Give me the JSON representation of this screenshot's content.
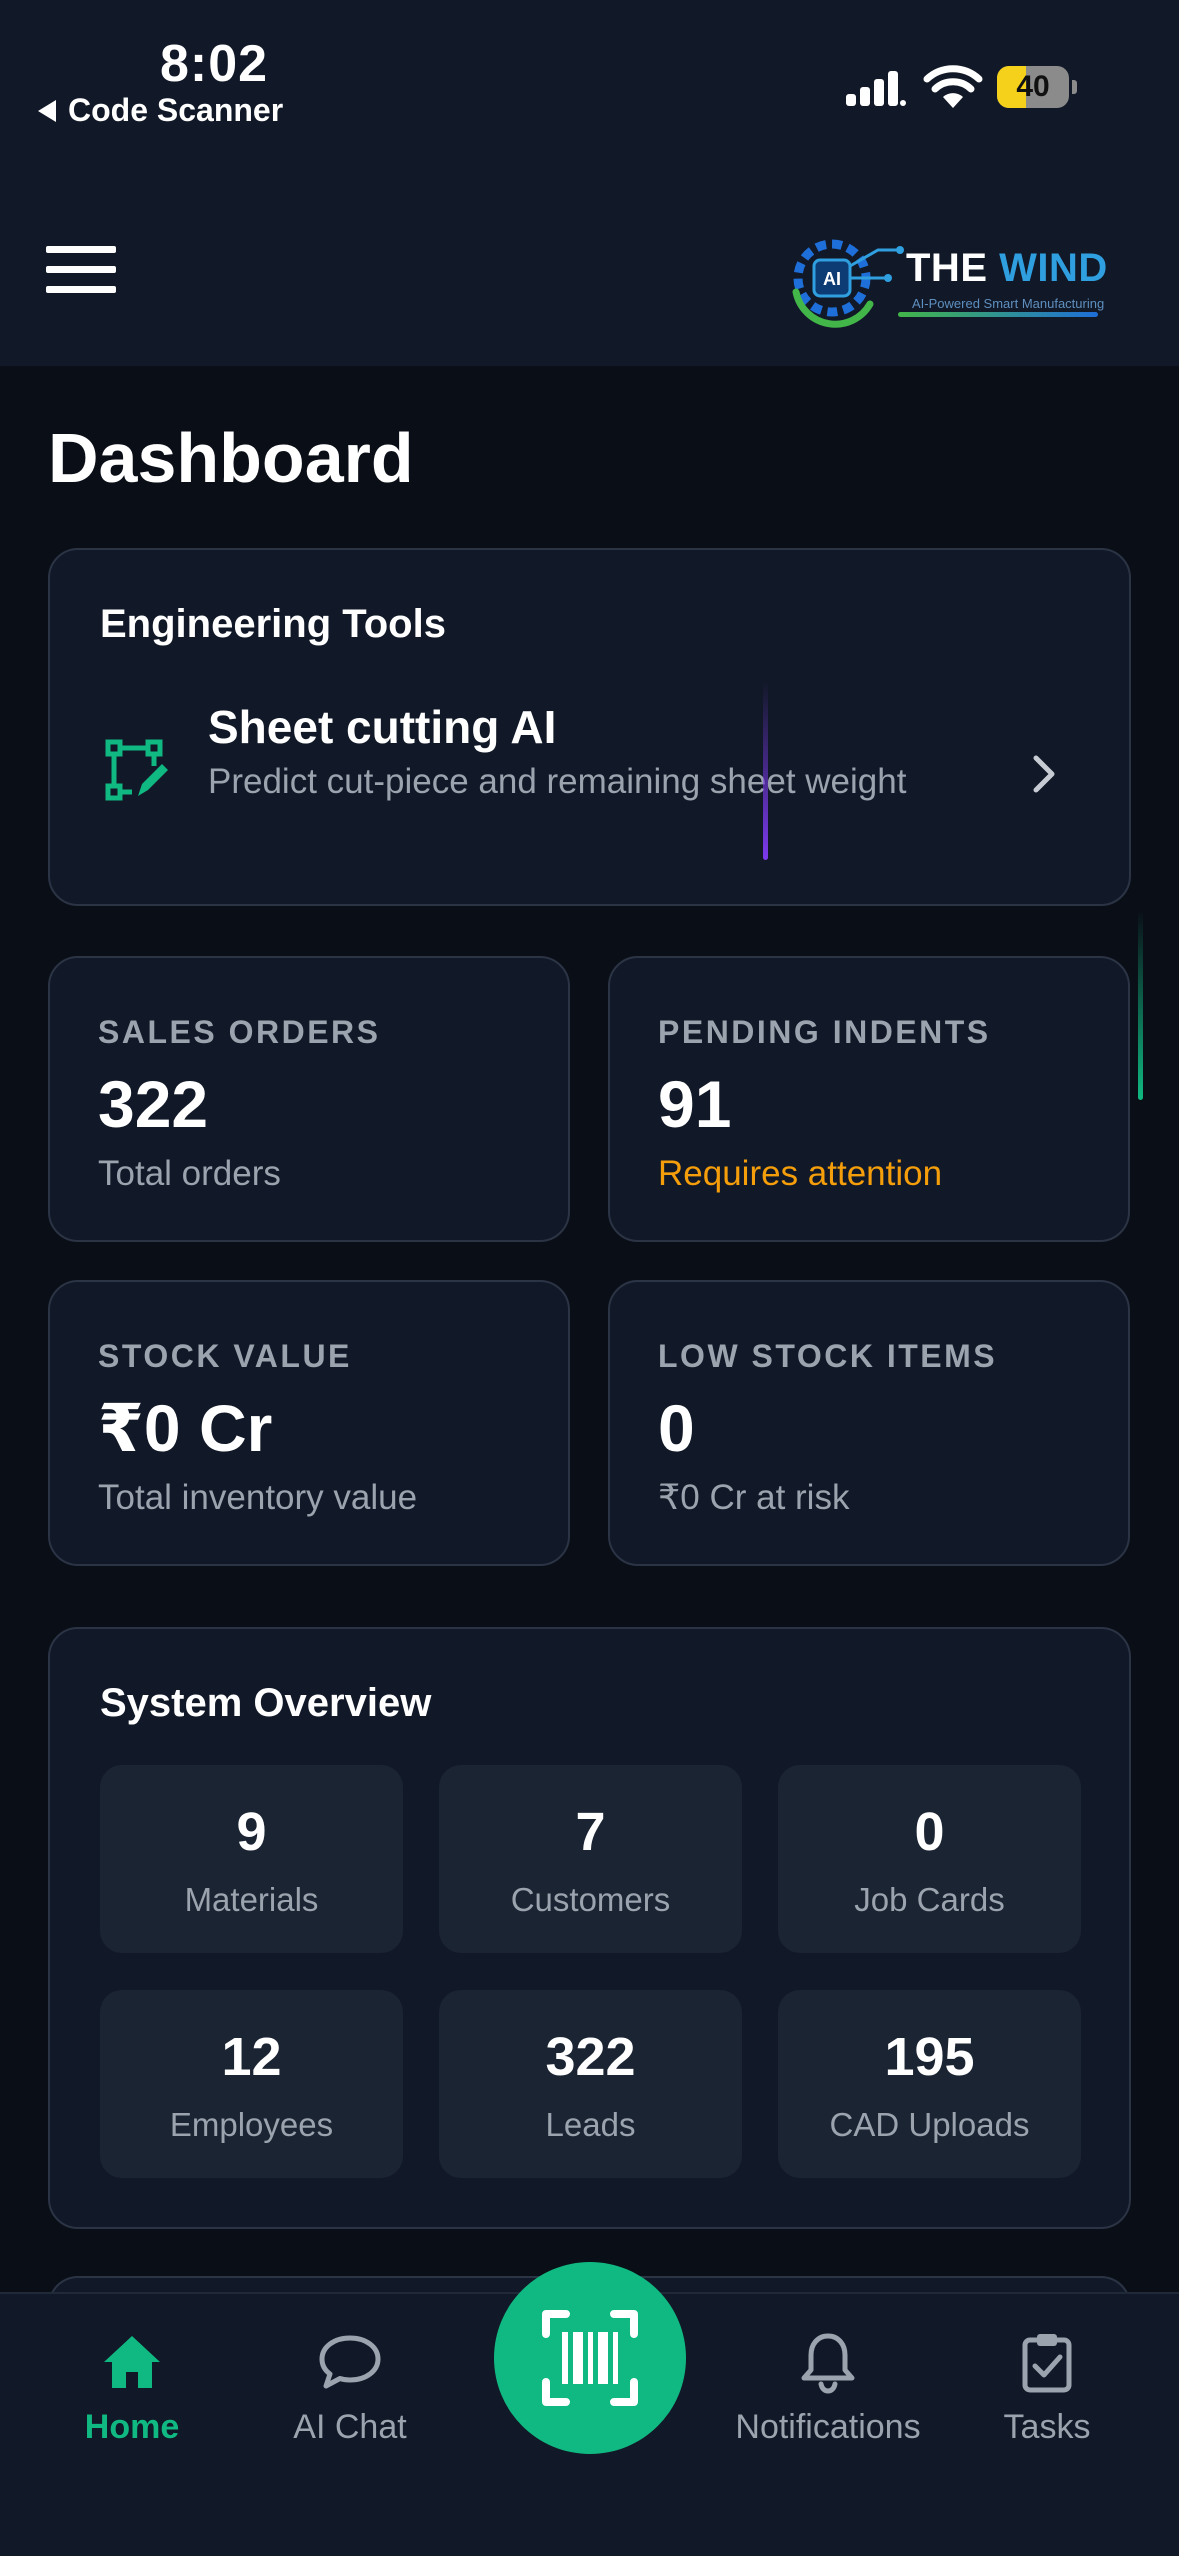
{
  "status_bar": {
    "time": "8:02",
    "back_app": "Code Scanner",
    "battery": "40",
    "battery_level": 0.4
  },
  "header": {
    "logo": {
      "word1": "THE",
      "word2": "WIND",
      "tagline": "AI-Powered Smart Manufacturing",
      "badge": "AI"
    }
  },
  "page": {
    "title": "Dashboard"
  },
  "engineering_tools": {
    "title": "Engineering Tools",
    "tool": {
      "name": "Sheet cutting AI",
      "description": "Predict cut-piece and remaining sheet weight",
      "icon": "vector-edit-icon"
    }
  },
  "stats": [
    {
      "label": "SALES ORDERS",
      "value": "322",
      "sub": "Total orders"
    },
    {
      "label": "PENDING INDENTS",
      "value": "91",
      "sub": "Requires attention"
    },
    {
      "label": "STOCK VALUE",
      "value": "₹0 Cr",
      "sub": "Total inventory value"
    },
    {
      "label": "LOW STOCK ITEMS",
      "value": "0",
      "sub": "₹0 Cr at risk"
    }
  ],
  "overview": {
    "title": "System Overview",
    "tiles": [
      {
        "value": "9",
        "label": "Materials"
      },
      {
        "value": "7",
        "label": "Customers"
      },
      {
        "value": "0",
        "label": "Job Cards"
      },
      {
        "value": "12",
        "label": "Employees"
      },
      {
        "value": "322",
        "label": "Leads"
      },
      {
        "value": "195",
        "label": "CAD Uploads"
      }
    ]
  },
  "nav": {
    "items": [
      {
        "label": "Home",
        "icon": "home-icon",
        "active": true
      },
      {
        "label": "AI Chat",
        "icon": "chat-bubble-icon",
        "active": false
      },
      {
        "label": "Notifications",
        "icon": "bell-icon",
        "active": false
      },
      {
        "label": "Tasks",
        "icon": "clipboard-check-icon",
        "active": false
      }
    ],
    "center_icon": "barcode-scanner-icon"
  },
  "colors": {
    "background": "#0a0e17",
    "surface": "#111827",
    "accent": "#10b981",
    "warning": "#f59e0b",
    "muted_text": "#9ba3af",
    "battery": "#f6d11b"
  }
}
